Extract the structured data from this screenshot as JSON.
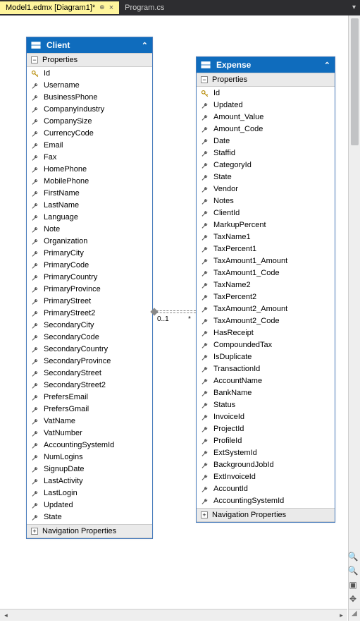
{
  "tabs": {
    "active": {
      "label": "Model1.edmx [Diagram1]*"
    },
    "other": {
      "label": "Program.cs"
    }
  },
  "assoc": {
    "leftCard": "0..1",
    "rightCard": "*"
  },
  "entity1": {
    "name": "Client",
    "propsHeader": "Properties",
    "navHeader": "Navigation Properties",
    "keyProp": "Id",
    "props": [
      "Username",
      "BusinessPhone",
      "CompanyIndustry",
      "CompanySize",
      "CurrencyCode",
      "Email",
      "Fax",
      "HomePhone",
      "MobilePhone",
      "FirstName",
      "LastName",
      "Language",
      "Note",
      "Organization",
      "PrimaryCity",
      "PrimaryCode",
      "PrimaryCountry",
      "PrimaryProvince",
      "PrimaryStreet",
      "PrimaryStreet2",
      "SecondaryCity",
      "SecondaryCode",
      "SecondaryCountry",
      "SecondaryProvince",
      "SecondaryStreet",
      "SecondaryStreet2",
      "PrefersEmail",
      "PrefersGmail",
      "VatName",
      "VatNumber",
      "AccountingSystemId",
      "NumLogins",
      "SignupDate",
      "LastActivity",
      "LastLogin",
      "Updated",
      "State"
    ]
  },
  "entity2": {
    "name": "Expense",
    "propsHeader": "Properties",
    "navHeader": "Navigation Properties",
    "keyProp": "Id",
    "props": [
      "Updated",
      "Amount_Value",
      "Amount_Code",
      "Date",
      "Staffid",
      "CategoryId",
      "State",
      "Vendor",
      "Notes",
      "ClientId",
      "MarkupPercent",
      "TaxName1",
      "TaxPercent1",
      "TaxAmount1_Amount",
      "TaxAmount1_Code",
      "TaxName2",
      "TaxPercent2",
      "TaxAmount2_Amount",
      "TaxAmount2_Code",
      "HasReceipt",
      "CompoundedTax",
      "IsDuplicate",
      "TransactionId",
      "AccountName",
      "BankName",
      "Status",
      "InvoiceId",
      "ProjectId",
      "ProfileId",
      "ExtSystemId",
      "BackgroundJobId",
      "ExtInvoiceId",
      "AccountId",
      "AccountingSystemId"
    ]
  }
}
